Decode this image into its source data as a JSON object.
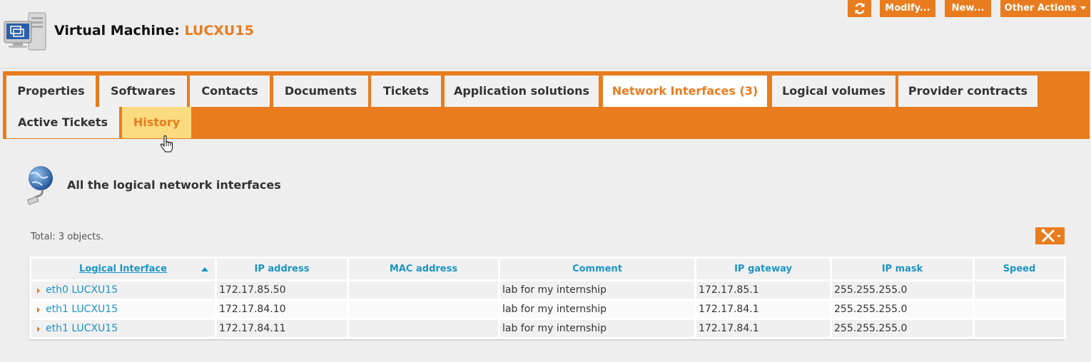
{
  "header": {
    "title_prefix": "Virtual Machine:",
    "title_name": "LUCXU15",
    "vm_icon": "virtual-machine-icon"
  },
  "actions": {
    "refresh_icon": "refresh-icon",
    "modify": "Modify...",
    "new": "New...",
    "other": "Other Actions"
  },
  "tabs": [
    {
      "label": "Properties"
    },
    {
      "label": "Softwares"
    },
    {
      "label": "Contacts"
    },
    {
      "label": "Documents"
    },
    {
      "label": "Tickets"
    },
    {
      "label": "Application solutions"
    },
    {
      "label": "Network Interfaces (3)"
    },
    {
      "label": "Logical volumes"
    },
    {
      "label": "Provider contracts"
    },
    {
      "label": "Active Tickets"
    },
    {
      "label": "History"
    }
  ],
  "section": {
    "title": "All the logical network interfaces",
    "icon": "network-interface-icon"
  },
  "list": {
    "total": "Total: 3 objects.",
    "tools_icon": "tools-icon",
    "columns": [
      "Logical Interface",
      "IP address",
      "MAC address",
      "Comment",
      "IP gateway",
      "IP mask",
      "Speed"
    ],
    "rows": [
      {
        "name": "eth0 LUCXU15",
        "ip": "172.17.85.50",
        "mac": "",
        "comment": "lab for my internship",
        "gateway": "172.17.85.1",
        "mask": "255.255.255.0",
        "speed": ""
      },
      {
        "name": "eth1 LUCXU15",
        "ip": "172.17.84.10",
        "mac": "",
        "comment": "lab for my internship",
        "gateway": "172.17.84.1",
        "mask": "255.255.255.0",
        "speed": ""
      },
      {
        "name": "eth1 LUCXU15",
        "ip": "172.17.84.11",
        "mac": "",
        "comment": "lab for my internship",
        "gateway": "172.17.84.1",
        "mask": "255.255.255.0",
        "speed": ""
      }
    ]
  },
  "colors": {
    "accent": "#e87c1e",
    "link": "#1c94c4",
    "tab_hover": "#fbdb7f"
  }
}
